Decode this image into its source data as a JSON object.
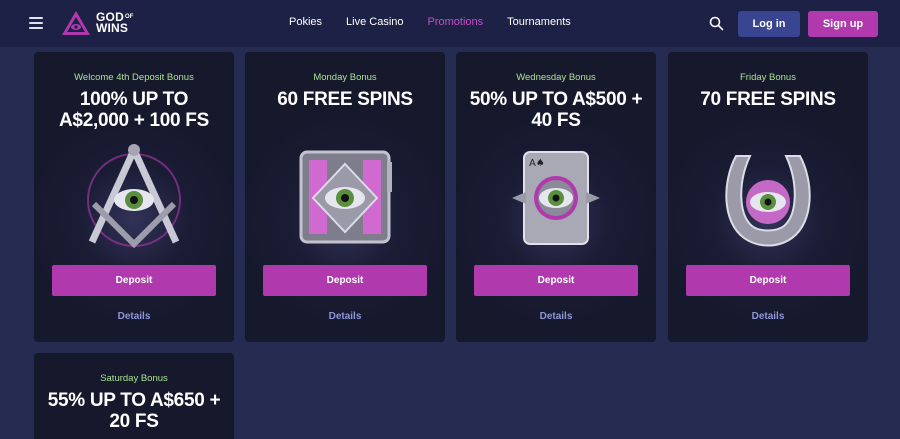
{
  "header": {
    "menu_icon": "hamburger-menu-icon",
    "logo": {
      "line1": "GOD",
      "of": "OF",
      "line2": "WINS"
    },
    "nav": [
      {
        "label": "Pokies",
        "active": false
      },
      {
        "label": "Live Casino",
        "active": false
      },
      {
        "label": "Promotions",
        "active": true
      },
      {
        "label": "Tournaments",
        "active": false
      }
    ],
    "search_icon": "search-icon",
    "login_label": "Log in",
    "signup_label": "Sign up"
  },
  "colors": {
    "header_bg": "#1d2145",
    "page_bg": "#262b52",
    "card_bg": "#16182c",
    "accent_pink": "#b039ad",
    "login_blue": "#3a4592",
    "subtitle_green": "#a9e294",
    "details_purple": "#8e96d6",
    "active_nav": "#c24fc4"
  },
  "promotions": [
    {
      "subtitle": "Welcome 4th Deposit Bonus",
      "title": "100% UP TO A$2,000 + 100 FS",
      "art_icon": "eye-compass-icon",
      "deposit_label": "Deposit",
      "details_label": "Details"
    },
    {
      "subtitle": "Monday Bonus",
      "title": "60 FREE SPINS",
      "art_icon": "eye-slot-machine-icon",
      "deposit_label": "Deposit",
      "details_label": "Details"
    },
    {
      "subtitle": "Wednesday Bonus",
      "title": "50% UP TO A$500 + 40 FS",
      "art_icon": "eye-playing-card-icon",
      "deposit_label": "Deposit",
      "details_label": "Details"
    },
    {
      "subtitle": "Friday Bonus",
      "title": "70 FREE SPINS",
      "art_icon": "eye-horseshoe-icon",
      "deposit_label": "Deposit",
      "details_label": "Details"
    },
    {
      "subtitle": "Saturday Bonus",
      "title": "55% UP TO A$650 + 20 FS"
    }
  ]
}
